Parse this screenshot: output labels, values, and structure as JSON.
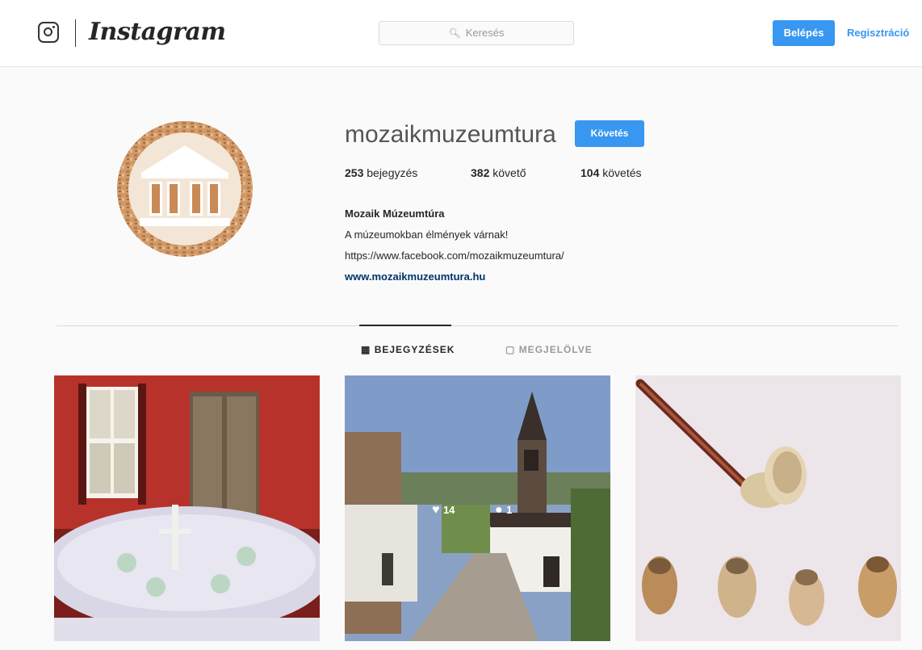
{
  "header": {
    "brand": "Instagram",
    "search_placeholder": "Keresés",
    "login_label": "Belépés",
    "signup_label": "Regisztráció"
  },
  "profile": {
    "username": "mozaikmuzeumtura",
    "follow_label": "Követés",
    "stats": {
      "posts_count": "253",
      "posts_label": "bejegyzés",
      "followers_count": "382",
      "followers_label": "követő",
      "following_count": "104",
      "following_label": "követés"
    },
    "bio": {
      "name": "Mozaik Múzeumtúra",
      "line1": "A múzeumokban élmények várnak!",
      "link": "https://www.facebook.com/mozaikmuzeumtura/",
      "website": "www.mozaikmuzeumtura.hu"
    }
  },
  "tabs": [
    {
      "label": "BEJEGYZÉSEK",
      "icon": "grid-icon",
      "active": true
    },
    {
      "label": "MEGJELÖLVE",
      "icon": "tag-icon",
      "active": false
    }
  ],
  "posts": [
    {
      "scene": "red room with laid table",
      "icon": "photo"
    },
    {
      "scene": "village street with church tower",
      "icon": "photo"
    },
    {
      "scene": "carved pipe and pipe bowls",
      "icon": "photo"
    }
  ],
  "colors": {
    "accent": "#3897f0",
    "avatar_bg": "#d19b6c"
  }
}
